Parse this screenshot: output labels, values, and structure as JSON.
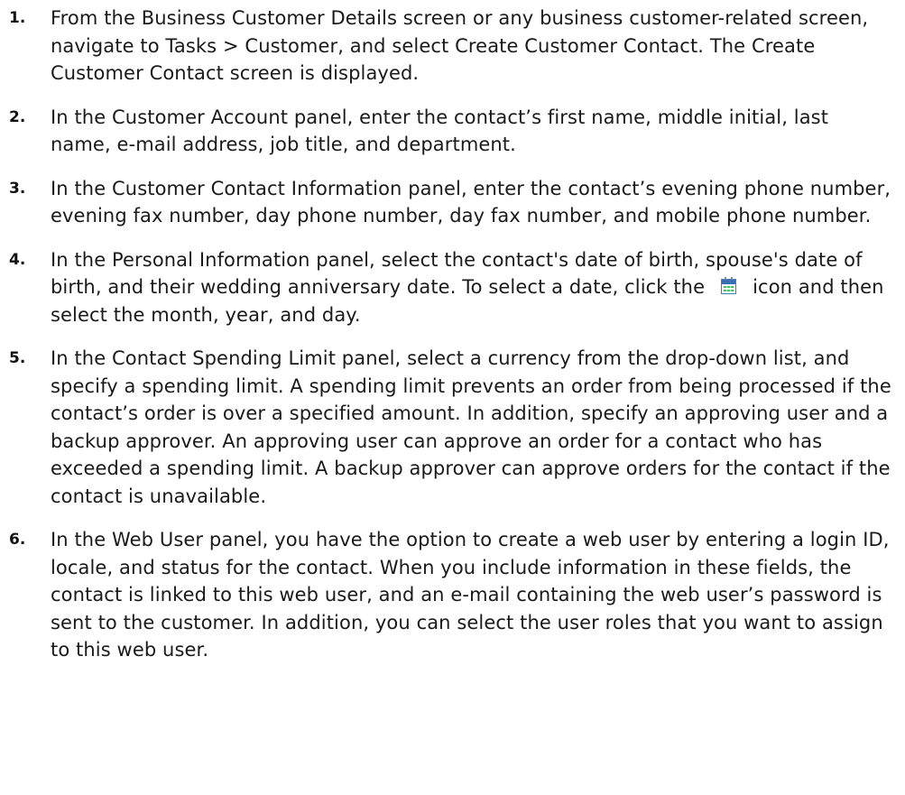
{
  "steps": [
    {
      "number": "1.",
      "text": "From the Business Customer Details screen or any business customer-related screen, navigate to Tasks > Customer, and select Create Customer Contact. The Create Customer Contact screen is displayed."
    },
    {
      "number": "2.",
      "text": "In the Customer Account panel, enter the contact’s first name, middle initial, last name, e-mail address, job title, and department."
    },
    {
      "number": "3.",
      "text": "In the Customer Contact Information panel, enter the contact’s evening phone number, evening fax number, day phone number, day fax number, and mobile phone number."
    },
    {
      "number": "4.",
      "text_before_icon": "In the Personal Information panel, select the contact's date of birth, spouse's date of birth, and their wedding anniversary date. To select a date, click the",
      "icon": "calendar-icon",
      "text_after_icon": "icon and then select the month, year, and day."
    },
    {
      "number": "5.",
      "text": "In the Contact Spending Limit panel, select a currency from the drop-down list, and specify a spending limit. A spending limit prevents an order from being processed if the contact’s order is over a specified amount. In addition, specify an approving user and a backup approver. An approving user can approve an order for a contact who has exceeded a spending limit. A backup approver can approve orders for the contact if the contact is unavailable."
    },
    {
      "number": "6.",
      "text": "In the Web User panel, you have the option to create a web user by entering a login ID, locale, and status for the contact. When you include information in these fields, the contact is linked to this web user, and an e-mail containing the web user’s password is sent to the customer. In addition, you can select the user roles that you want to assign to this web user."
    }
  ]
}
